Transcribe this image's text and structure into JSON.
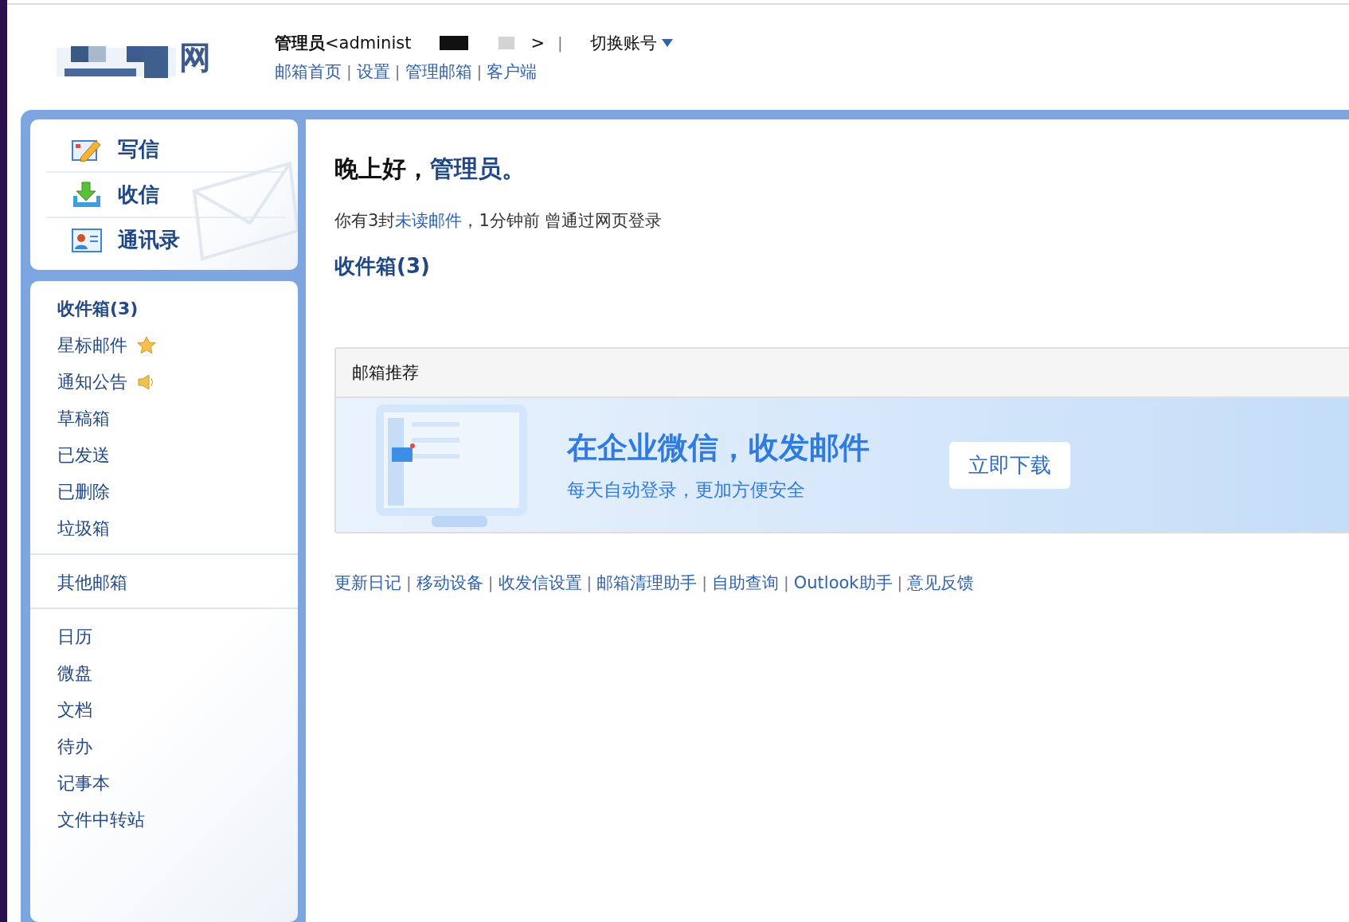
{
  "header": {
    "logo_text": "网",
    "user": {
      "name": "管理员",
      "email_visible": "<administ",
      "close": ">"
    },
    "divider": "|",
    "switch_account": "切换账号",
    "nav": [
      {
        "kind": "link",
        "label": "邮箱首页"
      },
      {
        "kind": "sep",
        "label": "|"
      },
      {
        "kind": "link",
        "label": "设置"
      },
      {
        "kind": "sep",
        "label": "|"
      },
      {
        "kind": "link",
        "label": "管理邮箱"
      },
      {
        "kind": "sep",
        "label": "|"
      },
      {
        "kind": "link",
        "label": "客户端"
      }
    ]
  },
  "actions": [
    {
      "kind": "compose",
      "label": "写信"
    },
    {
      "kind": "receive",
      "label": "收信"
    },
    {
      "kind": "contacts",
      "label": "通讯录"
    }
  ],
  "folder_groups": [
    [
      {
        "label": "收件箱(3)",
        "kind": "plain",
        "unread": true
      },
      {
        "label": "星标邮件",
        "kind": "star",
        "unread": false
      },
      {
        "label": "通知公告",
        "kind": "notice",
        "unread": false
      },
      {
        "label": "草稿箱",
        "kind": "plain",
        "unread": false
      },
      {
        "label": "已发送",
        "kind": "plain",
        "unread": false
      },
      {
        "label": "已删除",
        "kind": "plain",
        "unread": false
      },
      {
        "label": "垃圾箱",
        "kind": "plain",
        "unread": false
      }
    ],
    [
      {
        "label": "其他邮箱",
        "kind": "plain",
        "unread": false
      }
    ],
    [
      {
        "label": "日历",
        "kind": "plain",
        "unread": false
      },
      {
        "label": "微盘",
        "kind": "plain",
        "unread": false
      },
      {
        "label": "文档",
        "kind": "plain",
        "unread": false
      },
      {
        "label": "待办",
        "kind": "plain",
        "unread": false
      },
      {
        "label": "记事本",
        "kind": "plain",
        "unread": false
      },
      {
        "label": "文件中转站",
        "kind": "plain",
        "unread": false
      }
    ]
  ],
  "greeting": {
    "salutation": "晚上好，",
    "name": "管理员。"
  },
  "status": {
    "before": "你有3封",
    "link": "未读邮件",
    "after": "，1分钟前 曾通过网页登录"
  },
  "inbox_link": "收件箱(3)",
  "recommend": {
    "title": "邮箱推荐",
    "headline": "在企业微信，收发邮件",
    "subtitle": "每天自动登录，更加方便安全",
    "button": "立即下载"
  },
  "footer": [
    {
      "kind": "link",
      "label": "更新日记"
    },
    {
      "kind": "sep",
      "label": "|"
    },
    {
      "kind": "link",
      "label": "移动设备"
    },
    {
      "kind": "sep",
      "label": "|"
    },
    {
      "kind": "link",
      "label": "收发信设置"
    },
    {
      "kind": "sep",
      "label": "|"
    },
    {
      "kind": "link",
      "label": "邮箱清理助手"
    },
    {
      "kind": "sep",
      "label": "|"
    },
    {
      "kind": "link",
      "label": "自助查询"
    },
    {
      "kind": "sep",
      "label": "|"
    },
    {
      "kind": "link",
      "label": "Outlook助手"
    },
    {
      "kind": "sep",
      "label": "|"
    },
    {
      "kind": "link",
      "label": "意见反馈"
    }
  ]
}
